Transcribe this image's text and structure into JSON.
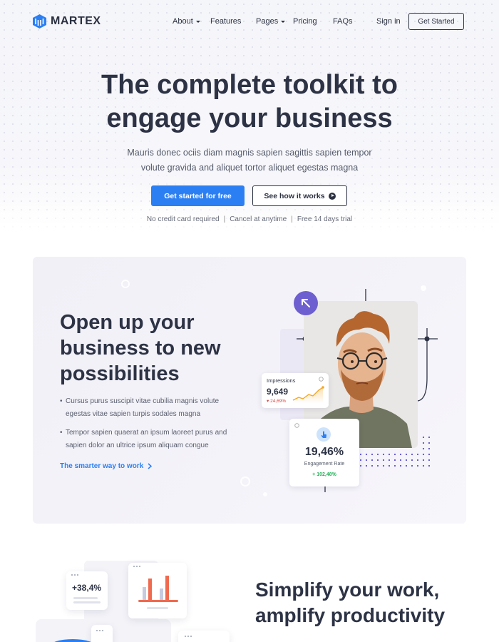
{
  "brand": {
    "name": "MARTEX",
    "accent": "#2b7ff3",
    "purple": "#6d5fcf"
  },
  "nav": {
    "items": [
      {
        "label": "About",
        "has_caret": true
      },
      {
        "label": "Features",
        "has_caret": false
      },
      {
        "label": "Pages",
        "has_caret": true
      },
      {
        "label": "Pricing",
        "has_caret": false
      },
      {
        "label": "FAQs",
        "has_caret": false
      }
    ],
    "sign_in": "Sign in",
    "get_started": "Get Started"
  },
  "hero": {
    "title_line1": "The complete toolkit to",
    "title_line2": "engage your business",
    "sub_line1": "Mauris donec ociis diam magnis sapien sagittis sapien tempor",
    "sub_line2": "volute gravida and aliquet tortor aliquet egestas magna",
    "primary_button": "Get started for free",
    "secondary_button": "See how it works",
    "notes": [
      "No credit card required",
      "Cancel at anytime",
      "Free 14 days trial"
    ]
  },
  "feature": {
    "title_line1": "Open up your",
    "title_line2": "business to new",
    "title_line3": "possibilities",
    "bullets": [
      "Cursus purus suscipit vitae cubilia magnis volute egestas vitae sapien turpis sodales magna",
      "Tempor sapien quaerat an ipsum laoreet purus and sapien dolor an ultrice ipsum aliquam congue"
    ],
    "link": "The smarter way to work",
    "impressions": {
      "label": "Impressions",
      "value": "9,649",
      "delta": "24,69%"
    },
    "engagement": {
      "value": "19,46%",
      "label": "Engagement Rate",
      "delta": "+ 102,48%"
    }
  },
  "bottom": {
    "title_line1": "Simplify your work,",
    "title_line2": "amplify productivity",
    "mini_value": "+38,4%"
  }
}
